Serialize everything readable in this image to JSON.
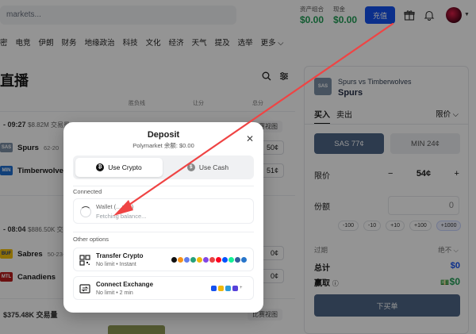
{
  "header": {
    "search_placeholder": "markets...",
    "portfolio_label": "资产组合",
    "portfolio_value": "$0.00",
    "cash_label": "现金",
    "cash_value": "$0.00",
    "deposit_label": "充值",
    "icons": [
      "gift-icon",
      "bell-icon",
      "avatar",
      "chevron-down-icon"
    ]
  },
  "nav": {
    "items": [
      "密",
      "电竞",
      "伊朗",
      "财务",
      "地缘政治",
      "科技",
      "文化",
      "经济",
      "天气",
      "提及",
      "选举"
    ],
    "more_label": "更多 ⌵"
  },
  "page": {
    "title": "直播",
    "col_headers": [
      "胜负线",
      "让分",
      "总分"
    ]
  },
  "games": [
    {
      "time": "- 09:27",
      "volume": "$8.82M 交易量",
      "chart_label": "比赛视图",
      "teams": [
        {
          "abbr": "SAS",
          "name": "Spurs",
          "record": "62-20",
          "price": "50¢",
          "color": "#7d8fa6"
        },
        {
          "abbr": "MIN",
          "name": "Timberwolves",
          "record": "",
          "price": "51¢",
          "color": "#1f6fd0"
        }
      ]
    },
    {
      "time": "- 08:04",
      "volume": "$886.50K 交易量",
      "chart_label": "",
      "teams": [
        {
          "abbr": "BUF",
          "name": "Sabres",
          "record": "50-23-9",
          "price": "0¢",
          "color": "#1e3a8a"
        },
        {
          "abbr": "MTL",
          "name": "Canadiens",
          "record": "",
          "price": "0¢",
          "color": "#b91c1c"
        }
      ]
    }
  ],
  "footer_volume": "$375.48K 交易量",
  "footer_chart_label": "比赛视图",
  "trade_panel": {
    "team_abbr": "SAS",
    "subtitle": "Spurs vs Timberwolves",
    "title": "Spurs",
    "tab_buy": "买入",
    "tab_sell": "卖出",
    "order_type": "限价 ⌵",
    "outcome_a": "SAS 77¢",
    "outcome_b": "MIN 24¢",
    "limit_label": "限价",
    "limit_minus": "−",
    "limit_value": "54¢",
    "limit_plus": "+",
    "shares_label": "份额",
    "shares_value": "0",
    "chips": [
      "-100",
      "-10",
      "+10",
      "+100",
      "+1000"
    ],
    "expiry_label": "过期",
    "expiry_value": "绝不 ⌵",
    "total_label": "总计",
    "total_value": "$0",
    "win_label": "赢取",
    "win_value": "$0",
    "submit_label": "下买单"
  },
  "modal": {
    "title": "Deposit",
    "subtitle": "Polymarket 余额: $0.00",
    "tab_crypto": "Use Crypto",
    "tab_cash": "Use Cash",
    "connected_label": "Connected",
    "wallet_name": "Wallet (…ɔ..9)",
    "wallet_status": "Fetching balance...",
    "other_label": "Other options",
    "options": [
      {
        "title": "Transfer Crypto",
        "sub": "No limit • Instant",
        "icon": "qr-code-icon"
      },
      {
        "title": "Connect Exchange",
        "sub": "No limit • 2 min",
        "icon": "exchange-icon"
      }
    ],
    "coin_colors": [
      "#111111",
      "#f7931a",
      "#627eea",
      "#26a17b",
      "#f0b90b",
      "#8247e5",
      "#e84142",
      "#ff0420",
      "#0052ff",
      "#14f195",
      "#345d9d",
      "#2775ca"
    ],
    "exchange_colors": [
      "#1652f0",
      "#f0b90b",
      "#2d9cdb",
      "#5741d9"
    ],
    "exchange_more": "+"
  }
}
